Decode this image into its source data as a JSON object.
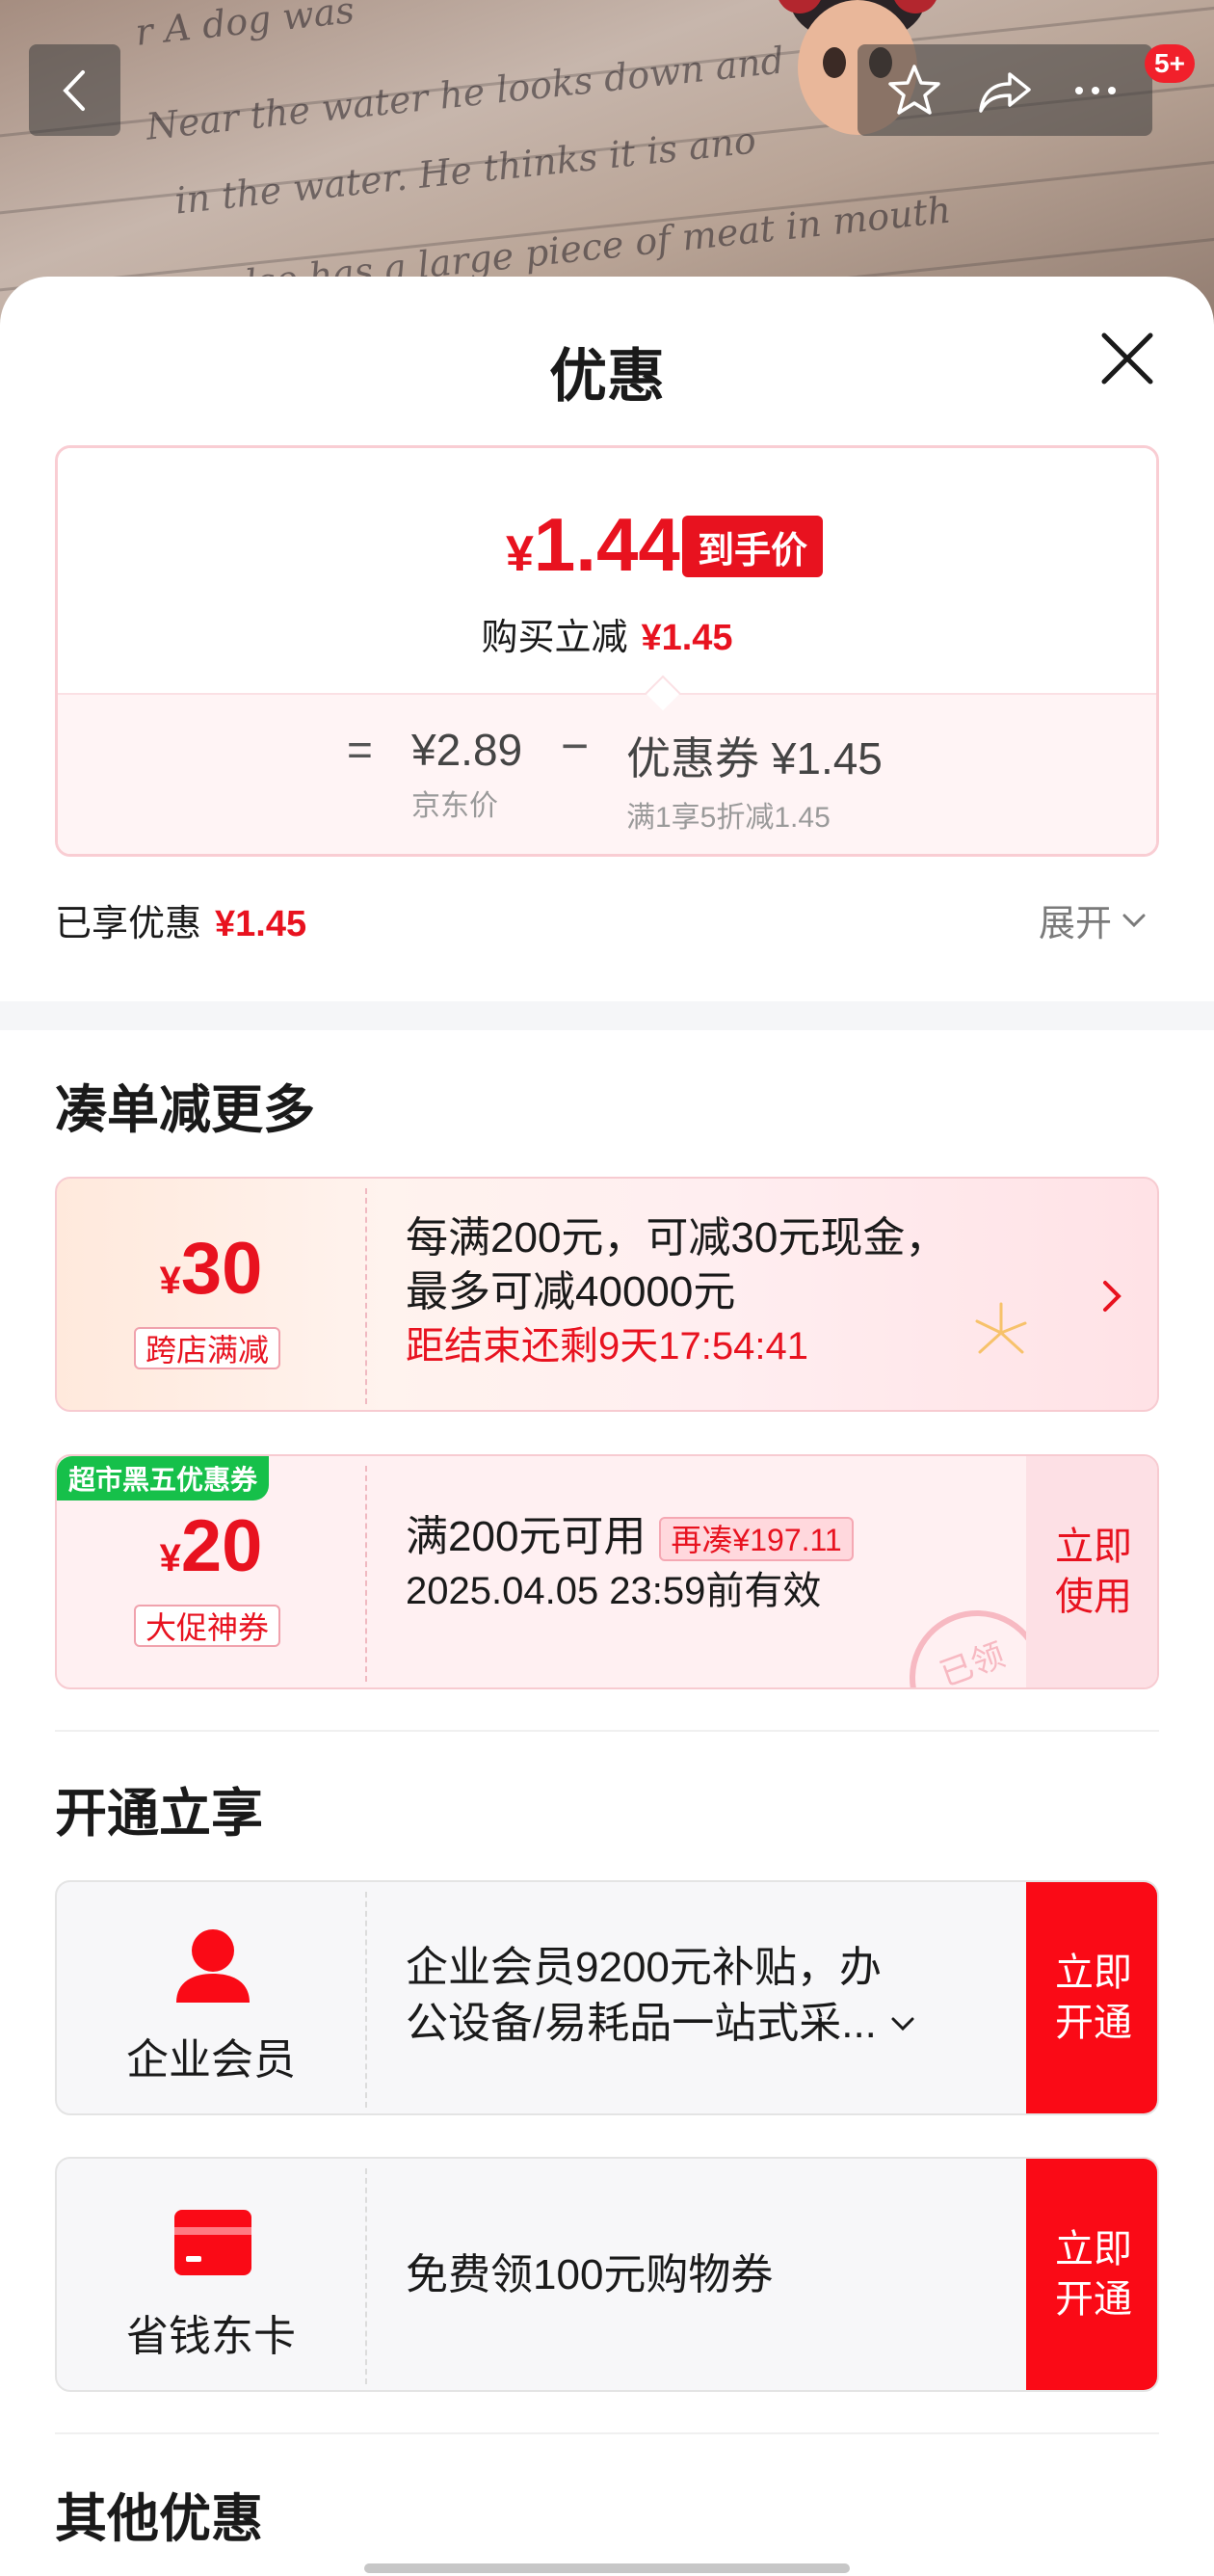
{
  "header": {
    "badge": "5+"
  },
  "sheet": {
    "title": "优惠"
  },
  "price": {
    "currency": "¥",
    "final_value": "1.44",
    "final_tag": "到手价",
    "instant_label": "购买立减",
    "instant_value": "¥1.45",
    "equals": "=",
    "minus": "−",
    "jd_price": "¥2.89",
    "jd_price_label": "京东价",
    "coupon_main": "优惠券 ¥1.45",
    "coupon_sub": "满1享5折减1.45"
  },
  "enjoyed": {
    "label": "已享优惠",
    "value": "¥1.45",
    "expand_label": "展开"
  },
  "section_more": {
    "title": "凑单减更多",
    "promo": {
      "currency": "¥",
      "amount": "30",
      "tag": "跨店满减",
      "line1": "每满200元，可减30元现金，",
      "line2": "最多可减40000元",
      "countdown": "距结束还剩9天17:54:41"
    },
    "coupon": {
      "badge": "超市黑五优惠券",
      "currency": "¥",
      "amount": "20",
      "tag": "大促神券",
      "condition": "满200元可用",
      "reduce_tag": "再凑¥197.11",
      "validity": "2025.04.05 23:59前有效",
      "use_label_1": "立即",
      "use_label_2": "使用",
      "stamp": "已领"
    }
  },
  "section_open": {
    "title": "开通立享",
    "items": [
      {
        "name": "企业会员",
        "icon": "person-icon",
        "line1": "企业会员9200元补贴，办",
        "line2": "公设备/易耗品一站式采...",
        "btn_1": "立即",
        "btn_2": "开通"
      },
      {
        "name": "省钱东卡",
        "icon": "card-icon",
        "line1": "免费领100元购物券",
        "btn_1": "立即",
        "btn_2": "开通"
      }
    ]
  },
  "section_other": {
    "title": "其他优惠"
  },
  "colors": {
    "accent_red": "#e8121f",
    "green_badge": "#16c04a",
    "open_button": "#fa0a16"
  }
}
